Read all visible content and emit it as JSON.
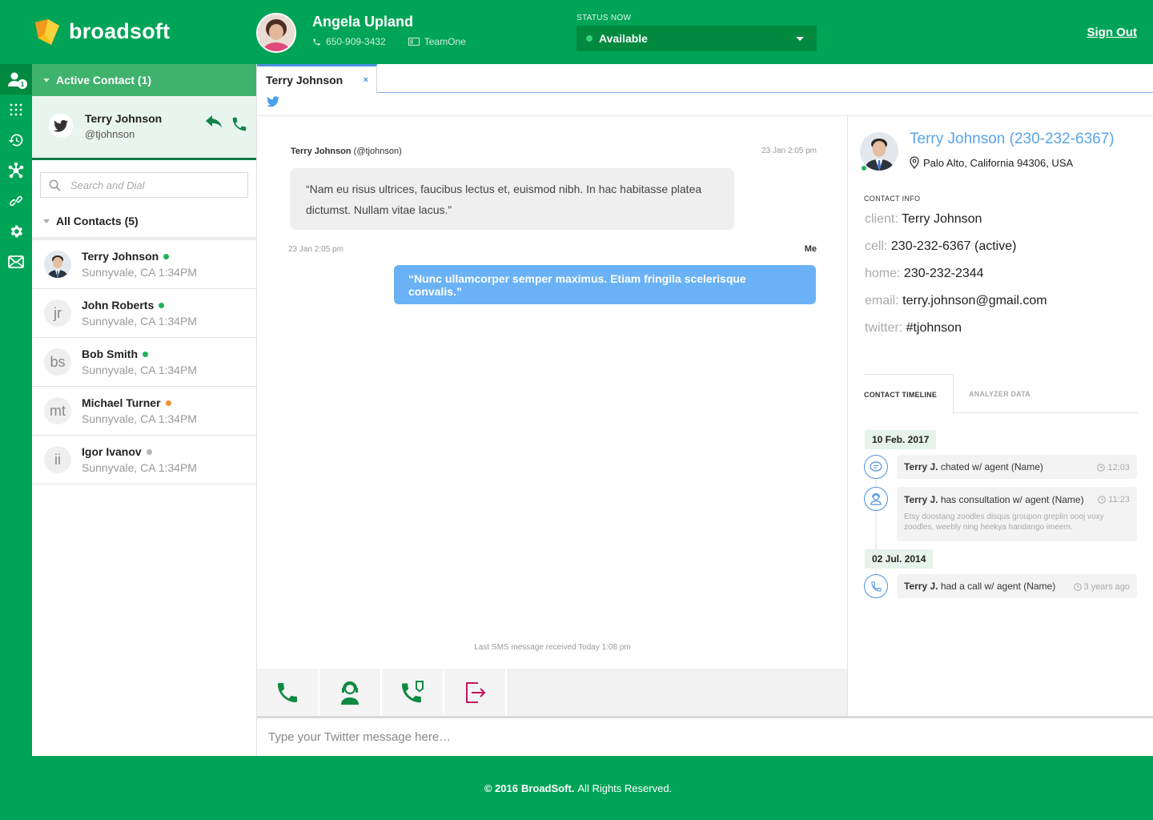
{
  "brand": {
    "name": "broadsoft"
  },
  "agent": {
    "name": "Angela Upland",
    "phone": "650-909-3432",
    "team": "TeamOne"
  },
  "status": {
    "label": "STATUS NOW",
    "value": "Available"
  },
  "header": {
    "signout_label": "Sign Out"
  },
  "rail": {
    "badge": "1",
    "icons": [
      "contacts-icon",
      "dialpad-icon",
      "history-icon",
      "network-icon",
      "link-icon",
      "settings-icon",
      "mail-icon"
    ]
  },
  "active": {
    "header": "Active Contact (1)",
    "contact": {
      "name": "Terry Johnson",
      "handle": "@tjohnson"
    }
  },
  "search": {
    "placeholder": "Search and Dial"
  },
  "all_contacts": {
    "header": "All Contacts (5)",
    "items": [
      {
        "name": "Terry Johnson",
        "initials": "",
        "location": "Sunnyvale, CA 1:34PM",
        "presence_color": "#22b25a"
      },
      {
        "name": "John Roberts",
        "initials": "jr",
        "location": "Sunnyvale, CA 1:34PM",
        "presence_color": "#22b25a"
      },
      {
        "name": "Bob Smith",
        "initials": "bs",
        "location": "Sunnyvale, CA 1:34PM",
        "presence_color": "#22b25a"
      },
      {
        "name": "Michael Turner",
        "initials": "mt",
        "location": "Sunnyvale, CA 1:34PM",
        "presence_color": "#f0913a"
      },
      {
        "name": "Igor Ivanov",
        "initials": "ii",
        "location": "Sunnyvale, CA 1:34PM",
        "presence_color": "#b5b5b5"
      }
    ]
  },
  "tab": {
    "label": "Terry Johnson",
    "close": "×"
  },
  "chat": {
    "incoming": {
      "name": "Terry Johnson",
      "handle": "(@tjohnson)",
      "time": "23 Jan 2:05 pm",
      "text": "“Nam eu risus ultrices, faucibus lectus et, euismod nibh. In hac habitasse platea dictumst. Nullam vitae lacus.”"
    },
    "outgoing": {
      "time": "23 Jan 2:05 pm",
      "sender": "Me",
      "text": "“Nunc ullamcorper semper maximus. Etiam fringila scelerisque convalis.”"
    },
    "last_sms": "Last SMS message received Today 1:08 pm"
  },
  "compose": {
    "placeholder": "Type your Twitter message here…"
  },
  "details": {
    "name": "Terry Johnson (230-232-6367)",
    "location": "Palo Alto, California 94306, USA",
    "contact_info_label": "CONTACT INFO",
    "fields": [
      {
        "key": "client:",
        "value": "Terry Johnson"
      },
      {
        "key": "cell:",
        "value": "230-232-6367 (active)"
      },
      {
        "key": "home:",
        "value": "230-232-2344"
      },
      {
        "key": "email:",
        "value": "terry.johnson@gmail.com"
      },
      {
        "key": "twitter:",
        "value": "#tjohnson"
      }
    ],
    "tabs": {
      "timeline": "CONTACT TIMELINE",
      "analyzer": "ANALYZER DATA"
    },
    "timeline": {
      "date1": "10 Feb. 2017",
      "date2": "02 Jul. 2014",
      "events": [
        {
          "who": "Terry J.",
          "text": "chated w/ agent (Name)",
          "time": "12:03",
          "desc": ""
        },
        {
          "who": "Terry J.",
          "text": "has consultation w/ agent (Name)",
          "time": "11:23",
          "desc": "Etsy doostang zoodles disqus groupon greplin oooj voxy zoodles, weebly ning heekya handango imeem."
        },
        {
          "who": "Terry J.",
          "text": "had a call w/ agent (Name)",
          "time": "3 years ago",
          "desc": ""
        }
      ]
    }
  },
  "footer": {
    "copyright": "© 2016",
    "company": "BroadSoft.",
    "rights": "All Rights Reserved."
  },
  "colors": {
    "brand_green": "#00a457",
    "dark_green": "#00893f",
    "accent_blue": "#4a90e2",
    "outgoing_bubble": "#6ab2f5",
    "end_chat": "#c0185a"
  }
}
